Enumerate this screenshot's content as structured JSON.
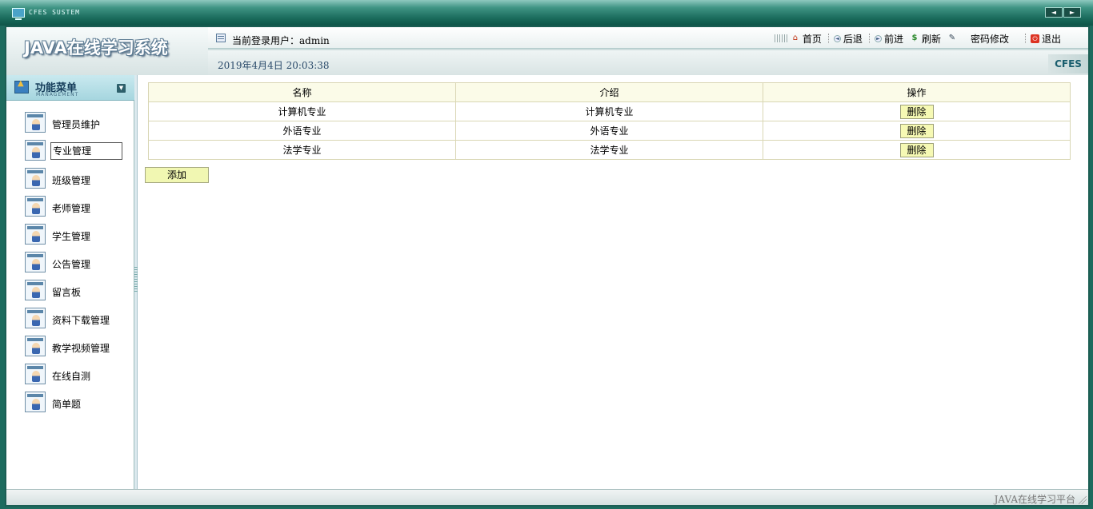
{
  "window": {
    "system_title": "CFES SUSTEM",
    "nav_prev": "◄",
    "nav_next": "►"
  },
  "header": {
    "logo": "JAVA在线学习系统",
    "user_label": "当前登录用户：admin",
    "date": "2019年4月4日  20:03:38",
    "brand": "CFES",
    "toolbar": {
      "home": "首页",
      "back": "后退",
      "forward": "前进",
      "refresh": "刷新",
      "password": "密码修改",
      "logout": "退出"
    }
  },
  "sidebar": {
    "title": "功能菜单",
    "subtitle": "MANAGEMENT",
    "items": [
      {
        "label": "管理员维护"
      },
      {
        "label": "专业管理"
      },
      {
        "label": "班级管理"
      },
      {
        "label": "老师管理"
      },
      {
        "label": "学生管理"
      },
      {
        "label": "公告管理"
      },
      {
        "label": "留言板"
      },
      {
        "label": "资料下载管理"
      },
      {
        "label": "教学视频管理"
      },
      {
        "label": "在线自测"
      },
      {
        "label": "简单题"
      }
    ]
  },
  "table": {
    "columns": [
      "名称",
      "介绍",
      "操作"
    ],
    "rows": [
      {
        "name": "计算机专业",
        "intro": "计算机专业",
        "action": "删除"
      },
      {
        "name": "外语专业",
        "intro": "外语专业",
        "action": "删除"
      },
      {
        "name": "法学专业",
        "intro": "法学专业",
        "action": "删除"
      }
    ]
  },
  "add_button": "添加",
  "footer": {
    "text": "JAVA在线学习平台"
  }
}
